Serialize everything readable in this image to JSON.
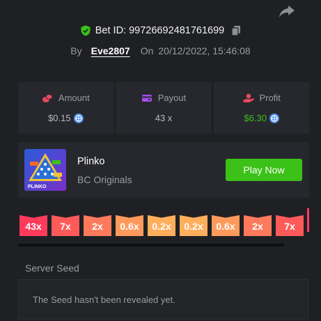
{
  "header": {
    "bet_id_label": "Bet ID: 99726692481761699",
    "by_label": "By",
    "username": "Eve2807",
    "on_label": "On",
    "datetime": "20/12/2022, 15:46:08"
  },
  "stats": [
    {
      "label": "Amount",
      "value": "$0.15",
      "icon": "coins-icon",
      "has_coin": true
    },
    {
      "label": "Payout",
      "value": "43 x",
      "icon": "wallet-icon",
      "has_coin": false
    },
    {
      "label": "Profit",
      "value": "$6.30",
      "icon": "profit-hand-icon",
      "has_coin": true
    }
  ],
  "game": {
    "name": "Plinko",
    "provider": "BC Originals",
    "thumb_text": "PLINKO",
    "play_label": "Play Now"
  },
  "multipliers": [
    "43x",
    "7x",
    "2x",
    "0.6x",
    "0.2x",
    "0.2x",
    "0.6x",
    "2x",
    "7x"
  ],
  "multiplier_colors": [
    "#ff3b5c",
    "#ff5a5a",
    "#ff7a5c",
    "#ff9a5c",
    "#ffae5c",
    "#ffae5c",
    "#ff9a5c",
    "#ff7a5c",
    "#ff5a5a"
  ],
  "seed": {
    "label": "Server Seed",
    "value": "The Seed hasn't been revealed yet."
  },
  "colors": {
    "accent_green": "#3bc117",
    "panel_bg": "#27282d",
    "page_bg": "#1f2023"
  }
}
